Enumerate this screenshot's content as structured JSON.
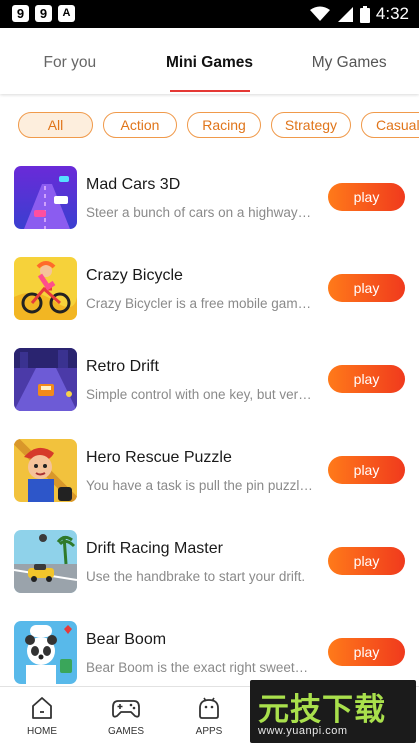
{
  "status_bar": {
    "time": "4:32",
    "badges": [
      "9",
      "9",
      "A"
    ]
  },
  "top_tabs": [
    {
      "label": "For you",
      "active": false
    },
    {
      "label": "Mini Games",
      "active": true
    },
    {
      "label": "My Games",
      "active": false
    }
  ],
  "categories": [
    {
      "label": "All",
      "active": true
    },
    {
      "label": "Action",
      "active": false
    },
    {
      "label": "Racing",
      "active": false
    },
    {
      "label": "Strategy",
      "active": false
    },
    {
      "label": "Casual",
      "active": false
    }
  ],
  "games": [
    {
      "title": "Mad Cars 3D",
      "description": "Steer a bunch of cars on a highway…",
      "play_label": "play",
      "icon": "mad-cars-thumbnail"
    },
    {
      "title": "Crazy Bicycle",
      "description": "Crazy Bicycler is a free mobile gam…",
      "play_label": "play",
      "icon": "bicycle-thumbnail"
    },
    {
      "title": "Retro Drift",
      "description": "Simple control with one key, but ver…",
      "play_label": "play",
      "icon": "retro-drift-thumbnail"
    },
    {
      "title": "Hero Rescue Puzzle",
      "description": "You have a task is pull the pin puzzl…",
      "play_label": "play",
      "icon": "hero-rescue-thumbnail"
    },
    {
      "title": "Drift Racing Master",
      "description": "Use the handbrake to start your drift.",
      "play_label": "play",
      "icon": "drift-racing-thumbnail"
    },
    {
      "title": "Bear Boom",
      "description": "Bear Boom is the exact right sweet…",
      "play_label": "play",
      "icon": "bear-boom-thumbnail"
    }
  ],
  "bottom_nav": [
    {
      "label": "HOME",
      "icon": "home-icon"
    },
    {
      "label": "GAMES",
      "icon": "gamepad-icon"
    },
    {
      "label": "APPS",
      "icon": "android-icon"
    }
  ],
  "watermark": {
    "big": "元⁠技下载",
    "small": "www.yuanpi.com"
  },
  "colors": {
    "accent_red": "#e53935",
    "chip_orange": "#e0751a",
    "play_start": "#ff7a1a",
    "play_end": "#f03a1d"
  }
}
